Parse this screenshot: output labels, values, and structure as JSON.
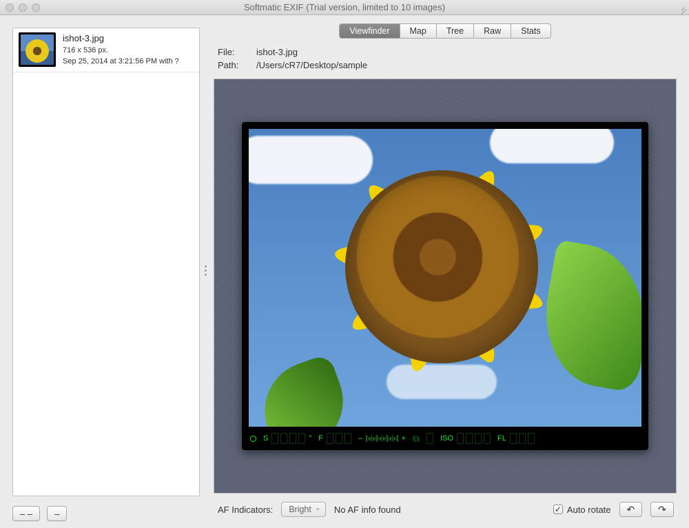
{
  "window": {
    "title": "Softmatic EXIF (Trial version, limited to 10 images)"
  },
  "sidebar": {
    "items": [
      {
        "filename": "ishot-3.jpg",
        "dimensions": "716 x 536 px.",
        "meta": "Sep 25, 2014 at 3:21:56 PM with ?"
      }
    ],
    "remove_all_label": "– –",
    "remove_label": "–"
  },
  "tabs": {
    "items": [
      "Viewfinder",
      "Map",
      "Tree",
      "Raw",
      "Stats"
    ],
    "active_index": 0
  },
  "details": {
    "file_label": "File:",
    "file_value": "ishot-3.jpg",
    "path_label": "Path:",
    "path_value": "/Users/cR7/Desktop/sample"
  },
  "viewfinder_strip": {
    "shutter_label": "S",
    "shutter_unit": "\"",
    "aperture_label": "F",
    "scale_minus": "–",
    "scale_plus": "+",
    "ev_symbol": "⧉",
    "iso_label": "ISO",
    "fl_label": "FL"
  },
  "footer": {
    "af_label": "AF Indicators:",
    "af_select": "Bright",
    "af_info": "No AF info found",
    "auto_rotate_label": "Auto rotate",
    "auto_rotate_checked": true,
    "rotate_cw": "↷",
    "rotate_ccw": "↶"
  }
}
